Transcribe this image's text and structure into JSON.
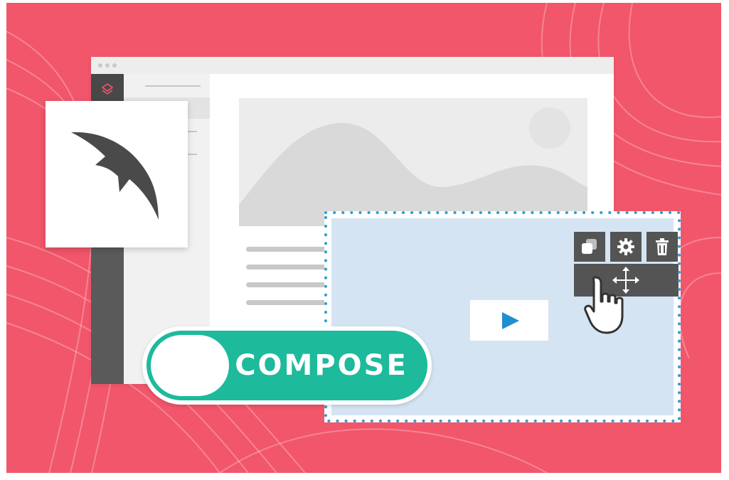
{
  "colors": {
    "background": "#f2566b",
    "toggle_accent": "#1dba9c",
    "toolbar": "#545454",
    "video_area": "#d5e4f2",
    "play_icon": "#1e8fd0",
    "dotted_border": "#2a9fd6"
  },
  "browser": {
    "icons": [
      "window-dots",
      "layers-logo-icon"
    ]
  },
  "logo_card": {
    "icon": "quill-feather-icon"
  },
  "video_block": {
    "icons": [
      "play-icon",
      "duplicate-icon",
      "gear-icon",
      "trash-icon",
      "move-arrows-icon"
    ]
  },
  "compose_toggle": {
    "label": "COMPOSE"
  },
  "cursor": {
    "icon": "hand-pointer-icon"
  }
}
